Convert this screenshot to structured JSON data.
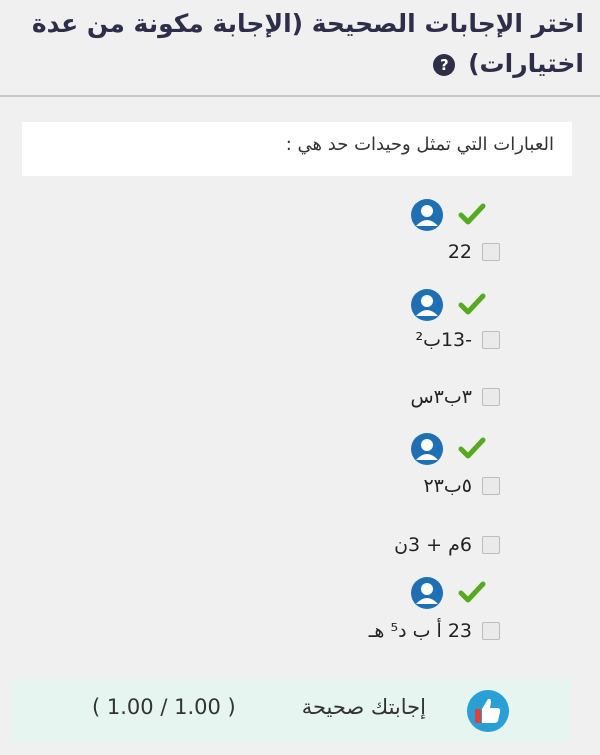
{
  "title": {
    "line1": "اختر الإجابات الصحيحة (الإجابة مكونة من عدة",
    "line2": "اختيارات)",
    "help_icon": "question-icon"
  },
  "question": {
    "text": "العبارات التي تمثل وحيدات حد هي :"
  },
  "answers": [
    {
      "text": "22",
      "correct": true
    },
    {
      "text": "-13ب²",
      "correct": true
    },
    {
      "text": "٣ب٣س",
      "correct": false
    },
    {
      "text": "٥ب٢٣",
      "correct": true
    },
    {
      "text": "6م + 3ن",
      "correct": false
    },
    {
      "text": "23 أ ب د⁵ هـ",
      "correct": true
    }
  ],
  "feedback": {
    "label": "إجابتك صحيحة",
    "score": "( 1.00 / 1.00 )"
  },
  "colors": {
    "check": "#55aa22",
    "user_icon": "#1f6fb5",
    "feedback_bg": "#e6f5f0"
  }
}
